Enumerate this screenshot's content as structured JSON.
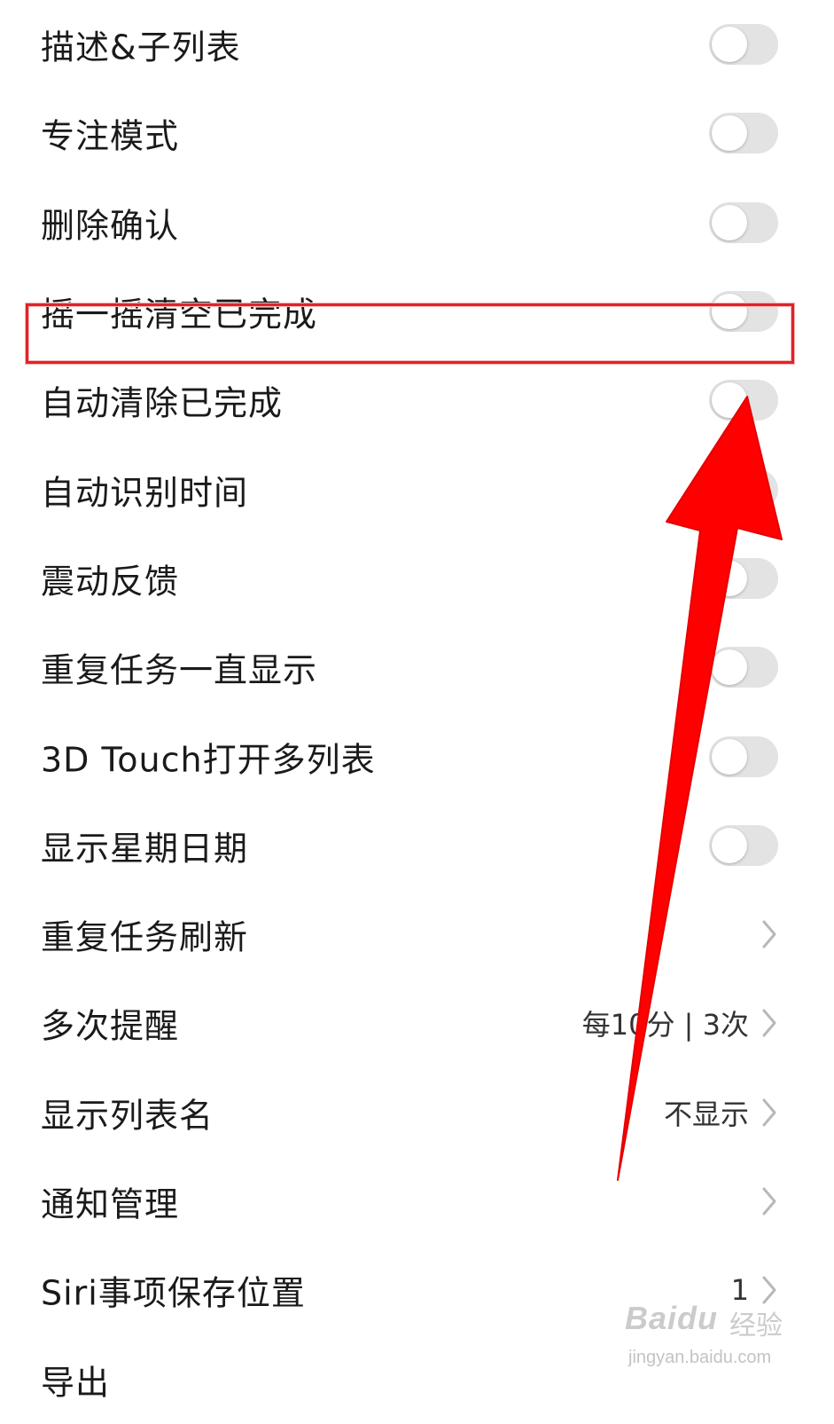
{
  "settings": {
    "rows": [
      {
        "label": "描述&子列表",
        "control": "toggle",
        "on": false
      },
      {
        "label": "专注模式",
        "control": "toggle",
        "on": false
      },
      {
        "label": "删除确认",
        "control": "toggle",
        "on": false
      },
      {
        "label": "摇一摇清空已完成",
        "control": "toggle",
        "on": false,
        "highlighted": true
      },
      {
        "label": "自动清除已完成",
        "control": "toggle",
        "on": false
      },
      {
        "label": "自动识别时间",
        "control": "toggle",
        "on": false
      },
      {
        "label": "震动反馈",
        "control": "toggle",
        "on": false
      },
      {
        "label": "重复任务一直显示",
        "control": "toggle",
        "on": false
      },
      {
        "label": "3D Touch打开多列表",
        "control": "toggle",
        "on": false
      },
      {
        "label": "显示星期日期",
        "control": "toggle",
        "on": false
      },
      {
        "label": "重复任务刷新",
        "control": "chevron",
        "value": ""
      },
      {
        "label": "多次提醒",
        "control": "chevron",
        "value": "每10分 | 3次"
      },
      {
        "label": "显示列表名",
        "control": "chevron",
        "value": "不显示"
      },
      {
        "label": "通知管理",
        "control": "chevron",
        "value": ""
      },
      {
        "label": "Siri事项保存位置",
        "control": "chevron",
        "value": "1"
      },
      {
        "label": "导出",
        "control": "chevron",
        "value": ""
      }
    ]
  },
  "colors": {
    "toggle_off": "#e3e3e3",
    "highlight": "#e0232a",
    "arrow": "#ff0000"
  },
  "watermark": {
    "logo": "Baidu",
    "cn": "经验",
    "url": "jingyan.baidu.com"
  }
}
